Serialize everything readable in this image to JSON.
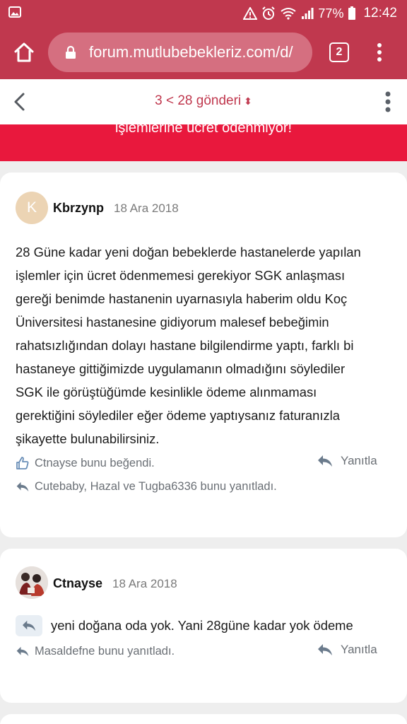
{
  "status_bar": {
    "battery": "77%",
    "time": "12:42"
  },
  "browser": {
    "url": "forum.mutlubebekleriz.com/d/",
    "tab_count": "2"
  },
  "nav": {
    "pager": "3 < 28 gönderi"
  },
  "banner": {
    "text": "işlemlerine ücret ödenmiyor!"
  },
  "posts": [
    {
      "author": "Kbrzynp",
      "avatar_letter": "K",
      "date": "18 Ara 2018",
      "lines": [
        "28 Güne kadar yeni doğan bebeklerde hastanelerde yapılan",
        "işlemler için ücret ödenmemesi gerekiyor SGK anlaşması",
        "gereği benimde hastanenin uyarnasıyla haberim oldu Koç",
        "Üniversitesi hastanesine gidiyorum malesef bebeğimin",
        "rahatsızlığından dolayı hastane bilgilendirme yaptı, farklı bi",
        "hastaneye gittiğimizde uygulamanın olmadığını söylediler",
        "SGK ile görüştüğümde kesinlikle ödeme alınmaması",
        "gerektiğini söylediler eğer ödeme yaptıysanız faturanızla",
        "şikayette bulunabilirsiniz."
      ],
      "liked": "Ctnayse bunu beğendi.",
      "replied": "Cutebaby, Hazal ve Tugba6336 bunu yanıtladı.",
      "reply_label": "Yanıtla"
    },
    {
      "author": "Ctnayse",
      "date": "18 Ara 2018",
      "text": "yeni doğana oda yok. Yani 28güne kadar yok ödeme",
      "replied": "Masaldefne bunu yanıtladı.",
      "reply_label": "Yanıtla"
    }
  ]
}
